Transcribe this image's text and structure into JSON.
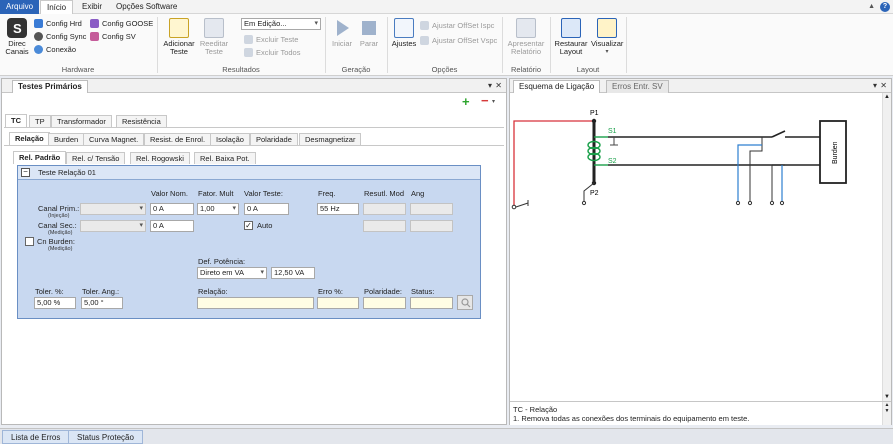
{
  "menu": {
    "tabs": [
      "Arquivo",
      "Início",
      "Exibir",
      "Opções Software"
    ]
  },
  "ribbon": {
    "hardware": {
      "label": "Hardware",
      "direc_canais": "Direc\nCanais",
      "config_hrd": "Config Hrd",
      "config_sync": "Config Sync",
      "conexao": "Conexão",
      "config_goose": "Config GOOSE",
      "config_sv": "Config SV"
    },
    "resultados": {
      "label": "Resultados",
      "adicionar_teste": "Adicionar\nTeste",
      "reeditar_teste": "Reeditar\nTeste",
      "status_select": "Em Edição...",
      "excluir_teste": "Excluir Teste",
      "excluir_todos": "Excluir Todos"
    },
    "geracao": {
      "label": "Geração",
      "iniciar": "Iniciar",
      "parar": "Parar"
    },
    "opcoes": {
      "label": "Opções",
      "ajustes": "Ajustes",
      "ajustar_ispc": "Ajustar OffSet Ispc",
      "ajustar_vspc": "Ajustar OffSet Vspc"
    },
    "relatorio": {
      "label": "Relatório",
      "apresentar": "Apresentar\nRelatório"
    },
    "layout": {
      "label": "Layout",
      "restaurar": "Restaurar\nLayout",
      "visualizar": "Visualizar"
    }
  },
  "left_panel": {
    "title": "Testes Primários",
    "main_tabs": [
      "TC",
      "TP",
      "Transformador",
      "Resistência"
    ],
    "sub_tabs": [
      "Relação",
      "Burden",
      "Curva Magnet.",
      "Resist. de Enrol.",
      "Isolação",
      "Polaridade",
      "Desmagnetizar"
    ],
    "rel_tabs": [
      "Rel. Padrão",
      "Rel. c/ Tensão",
      "Rel. Rogowski",
      "Rel. Baixa Pot."
    ],
    "group_title": "Teste Relação 01",
    "col_headers": {
      "valor_nom": "Valor Nom.",
      "fator_mult": "Fator. Mult",
      "valor_teste": "Valor Teste:",
      "freq": "Freq.",
      "result_mod": "Resutl. Mod",
      "ang": "Ang"
    },
    "canal_prim": {
      "label": "Canal Prim.:",
      "sub": "(Injeção)",
      "valor_nom": "0 A",
      "fator": "1,00",
      "valor_teste": "0 A",
      "freq": "55 Hz"
    },
    "canal_sec": {
      "label": "Canal Sec.:",
      "sub": "(Medição)",
      "valor_nom": "0 A",
      "auto": "Auto"
    },
    "cn_burden": {
      "label": "Cn Burden:",
      "sub": "(Medição)"
    },
    "def_potencia": {
      "label": "Def. Potência:",
      "mode": "Direto em VA",
      "value": "12,50 VA"
    },
    "toler": {
      "label": "Toler. %:",
      "value": "5,00 %"
    },
    "toler_ang": {
      "label": "Toler. Ang.:",
      "value": "5,00 °"
    },
    "relacao": {
      "label": "Relação:"
    },
    "erro": {
      "label": "Erro %:"
    },
    "polaridade": {
      "label": "Polaridade:"
    },
    "status": {
      "label": "Status:"
    }
  },
  "right_panel": {
    "tabs": [
      "Esquema de Ligação",
      "Erros Entr. SV"
    ],
    "diagram": {
      "p1": "P1",
      "p2": "P2",
      "s1": "S1",
      "s2": "S2",
      "burden": "Burden"
    },
    "info_title": "TC - Relação",
    "info_text": "1. Remova todas as conexões dos terminais do equipamento em teste."
  },
  "statusbar": {
    "tabs": [
      "Lista de Erros",
      "Status Proteção"
    ]
  },
  "colors": {
    "accent": "#2b64b8",
    "add": "#2da52d",
    "remove": "#d63a3a",
    "primary_wire": "#d8323a",
    "secondary_wire": "#2d7fd0",
    "coil": "#1aa04a"
  }
}
